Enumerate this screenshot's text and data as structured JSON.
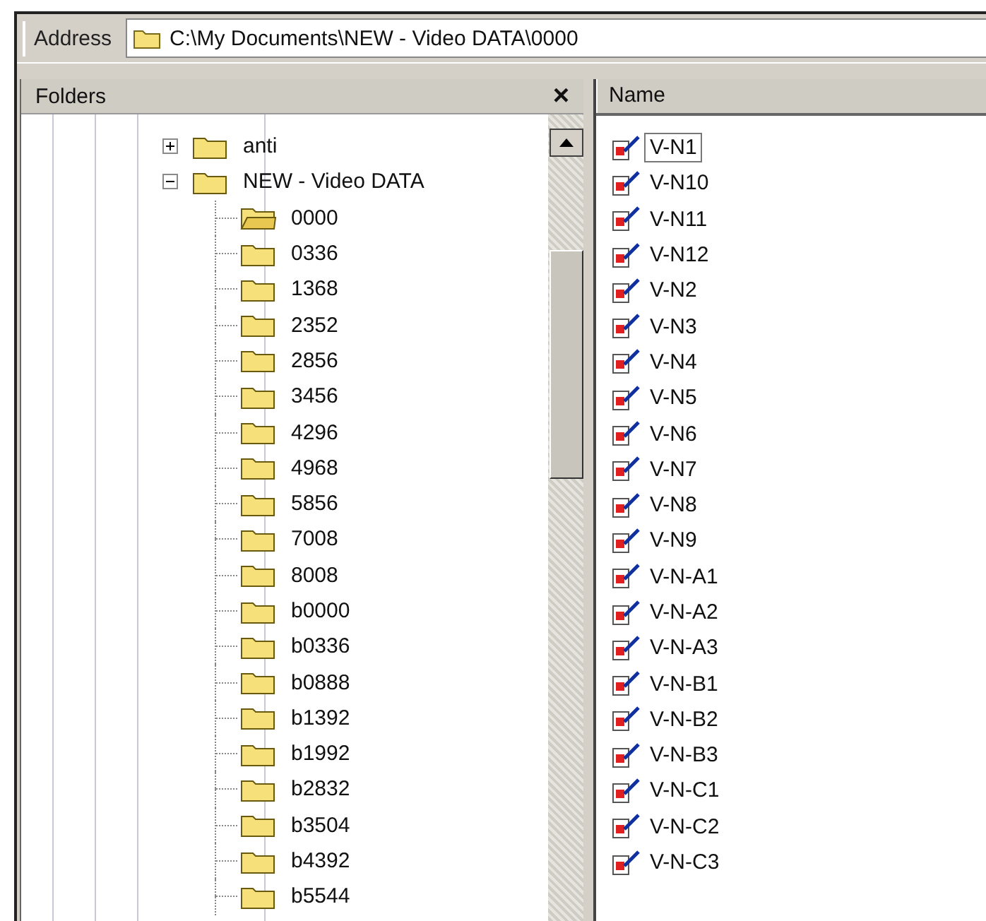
{
  "address_bar": {
    "label": "Address",
    "path": "C:\\My Documents\\NEW - Video DATA\\0000"
  },
  "folders_pane": {
    "title": "Folders",
    "close": "×",
    "tree": [
      {
        "name": "anti",
        "expanded": false,
        "selected": false
      },
      {
        "name": "NEW - Video DATA",
        "expanded": true,
        "selected": false,
        "children": [
          {
            "name": "0000",
            "selected": true
          },
          {
            "name": "0336",
            "selected": false
          },
          {
            "name": "1368",
            "selected": false
          },
          {
            "name": "2352",
            "selected": false
          },
          {
            "name": "2856",
            "selected": false
          },
          {
            "name": "3456",
            "selected": false
          },
          {
            "name": "4296",
            "selected": false
          },
          {
            "name": "4968",
            "selected": false
          },
          {
            "name": "5856",
            "selected": false
          },
          {
            "name": "7008",
            "selected": false
          },
          {
            "name": "8008",
            "selected": false
          },
          {
            "name": "b0000",
            "selected": false
          },
          {
            "name": "b0336",
            "selected": false
          },
          {
            "name": "b0888",
            "selected": false
          },
          {
            "name": "b1392",
            "selected": false
          },
          {
            "name": "b1992",
            "selected": false
          },
          {
            "name": "b2832",
            "selected": false
          },
          {
            "name": "b3504",
            "selected": false
          },
          {
            "name": "b4392",
            "selected": false
          },
          {
            "name": "b5544",
            "selected": false
          }
        ]
      }
    ]
  },
  "file_list": {
    "columns": [
      "Name"
    ],
    "files": [
      {
        "name": "V-N1",
        "selected": true
      },
      {
        "name": "V-N10",
        "selected": false
      },
      {
        "name": "V-N11",
        "selected": false
      },
      {
        "name": "V-N12",
        "selected": false
      },
      {
        "name": "V-N2",
        "selected": false
      },
      {
        "name": "V-N3",
        "selected": false
      },
      {
        "name": "V-N4",
        "selected": false
      },
      {
        "name": "V-N5",
        "selected": false
      },
      {
        "name": "V-N6",
        "selected": false
      },
      {
        "name": "V-N7",
        "selected": false
      },
      {
        "name": "V-N8",
        "selected": false
      },
      {
        "name": "V-N9",
        "selected": false
      },
      {
        "name": "V-N-A1",
        "selected": false
      },
      {
        "name": "V-N-A2",
        "selected": false
      },
      {
        "name": "V-N-A3",
        "selected": false
      },
      {
        "name": "V-N-B1",
        "selected": false
      },
      {
        "name": "V-N-B2",
        "selected": false
      },
      {
        "name": "V-N-B3",
        "selected": false
      },
      {
        "name": "V-N-C1",
        "selected": false
      },
      {
        "name": "V-N-C2",
        "selected": false
      },
      {
        "name": "V-N-C3",
        "selected": false
      }
    ]
  }
}
